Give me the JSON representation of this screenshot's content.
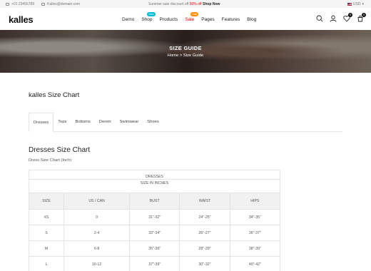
{
  "topbar": {
    "phone": "+01 23456789",
    "email": "Kalles@domain.com",
    "promo_prefix": "Summer sale discount off",
    "promo_highlight": "50% off",
    "promo_link": "Shop Now",
    "currency": "USD"
  },
  "header": {
    "logo": "kalles",
    "nav": [
      {
        "label": "Demo"
      },
      {
        "label": "Shop",
        "badge": "New"
      },
      {
        "label": "Products"
      },
      {
        "label": "Sale",
        "badge": "Sale"
      },
      {
        "label": "Pages"
      },
      {
        "label": "Features"
      },
      {
        "label": "Blog"
      }
    ],
    "wishlist_count": "0",
    "cart_count": "0"
  },
  "hero": {
    "title": "SIZE GUIDE",
    "breadcrumb_home": "Home",
    "breadcrumb_sep": ">",
    "breadcrumb_current": "Size Guide"
  },
  "page": {
    "title": "kalles Size Chart",
    "tabs": [
      "Dresses",
      "Tops",
      "Bottoms",
      "Denim",
      "Swimwear",
      "Shoes"
    ],
    "active_tab": "Dresses",
    "section_title": "Dresses Size Chart",
    "section_subtitle": "Dress Size Chart (Inch)"
  },
  "size_table": {
    "caption": "DRESSES",
    "caption_sub": "SIZE IN INCHES",
    "headers": [
      "SIZE",
      "US / CAN",
      "BUST",
      "WAIST",
      "HIPS"
    ],
    "rows": [
      [
        "XS",
        "0",
        "31\"-32\"",
        "24\"-25\"",
        "34\"-35\""
      ],
      [
        "S",
        "2-4",
        "33\"-34\"",
        "26\"-27\"",
        "36\"-37\""
      ],
      [
        "M",
        "6-8",
        "35\"-36\"",
        "28\"-29\"",
        "38\"-39\""
      ],
      [
        "L",
        "10-12",
        "37\"-39\"",
        "30\"-32\"",
        "40\"-42\""
      ]
    ]
  }
}
